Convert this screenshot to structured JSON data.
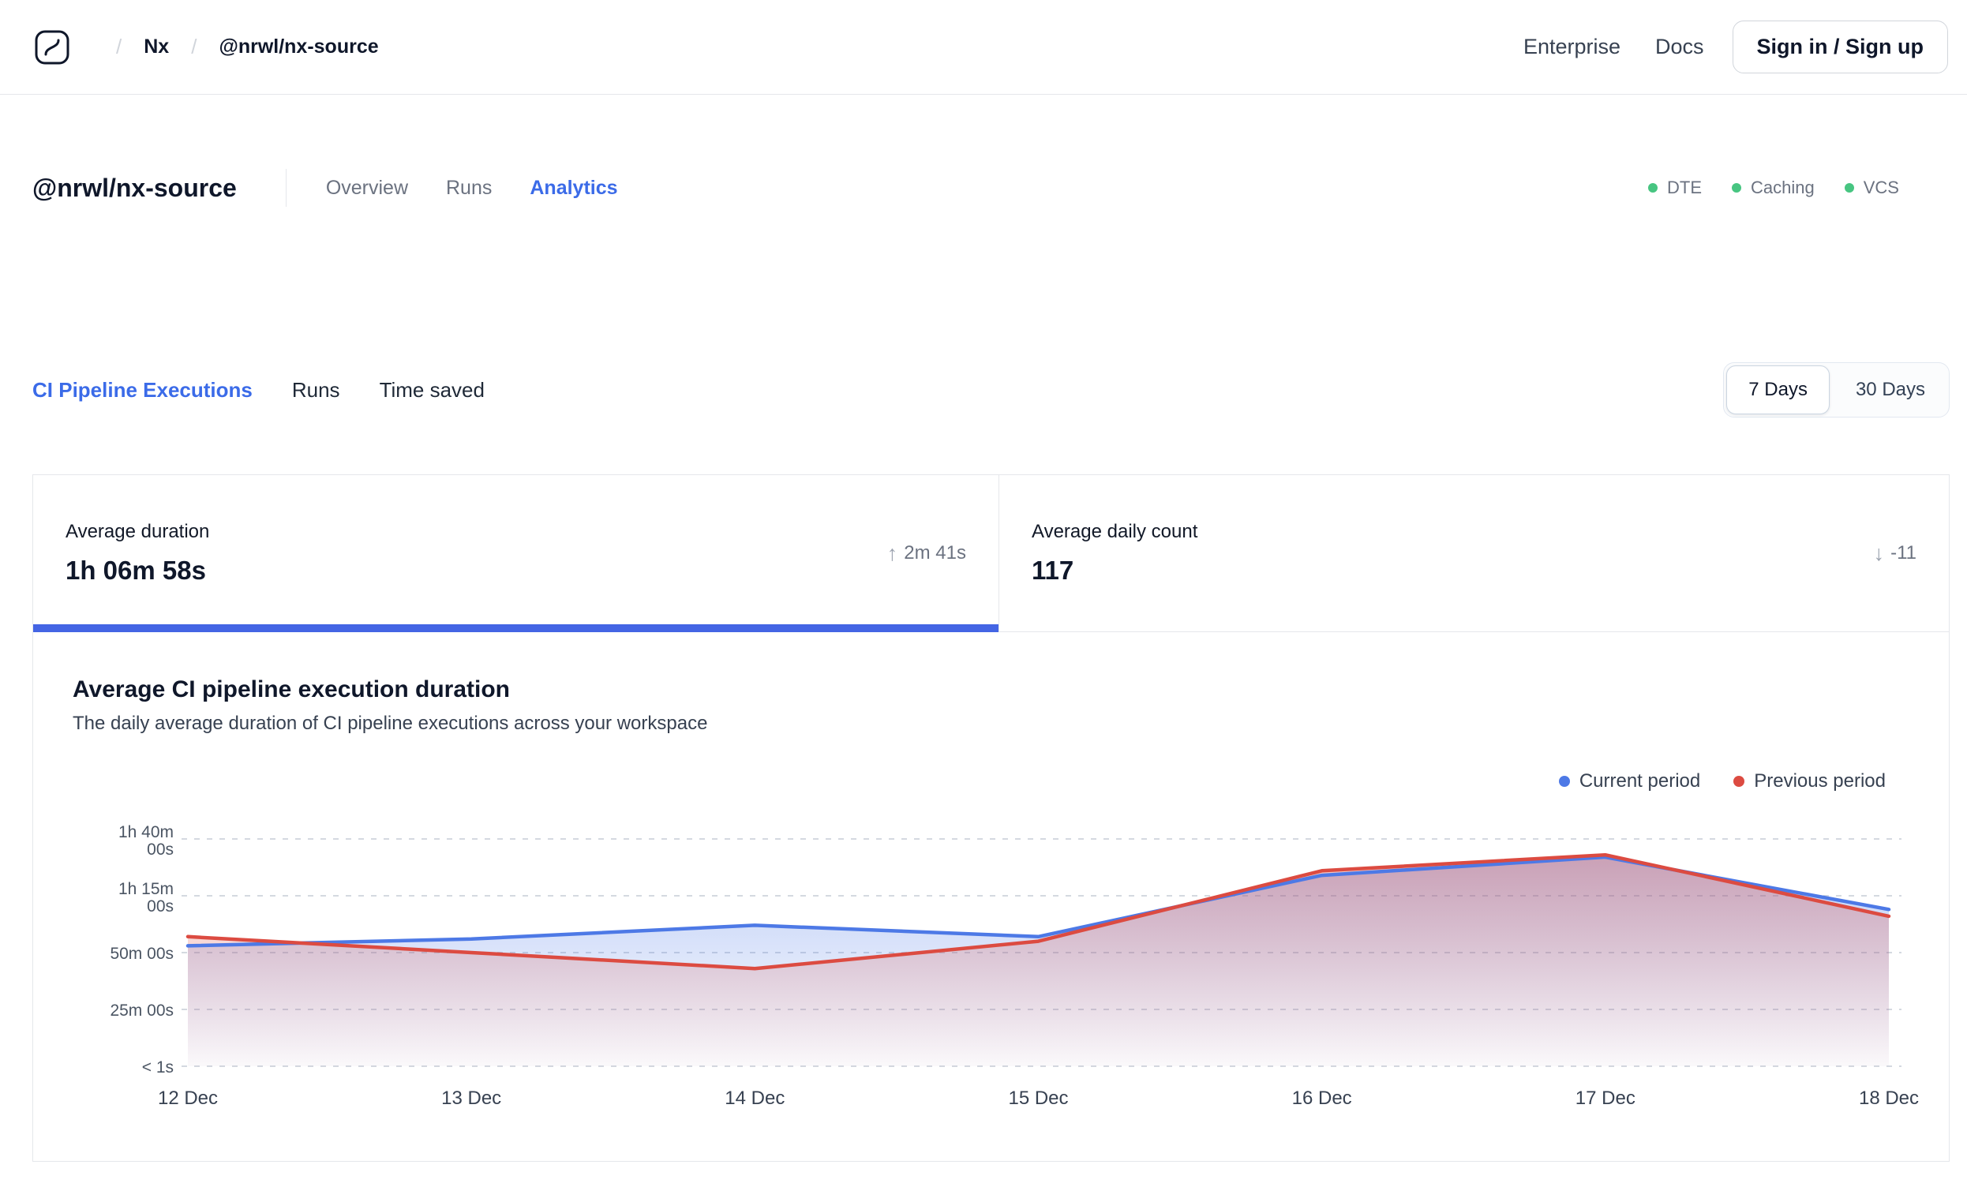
{
  "accents": {
    "blue": "#4465e4",
    "link_blue": "#3b6be8",
    "green": "#47c581",
    "border": "#e5e7eb"
  },
  "topbar": {
    "sep": "/",
    "org": "Nx",
    "repo": "@nrwl/nx-source",
    "links": [
      {
        "label": "Enterprise"
      },
      {
        "label": "Docs"
      }
    ],
    "signin_label": "Sign in / Sign up"
  },
  "workspace_header": {
    "title": "@nrwl/nx-source",
    "tabs": [
      {
        "label": "Overview",
        "active": false
      },
      {
        "label": "Runs",
        "active": false
      },
      {
        "label": "Analytics",
        "active": true
      }
    ],
    "status_badges": [
      {
        "label": "DTE"
      },
      {
        "label": "Caching"
      },
      {
        "label": "VCS"
      }
    ]
  },
  "analytics_nav": {
    "tabs": [
      {
        "label": "CI Pipeline Executions",
        "active": true
      },
      {
        "label": "Runs",
        "active": false
      },
      {
        "label": "Time saved",
        "active": false
      }
    ],
    "range_toggle": [
      {
        "label": "7 Days",
        "selected": true
      },
      {
        "label": "30 Days",
        "selected": false
      }
    ]
  },
  "metric_cards": [
    {
      "label": "Average duration",
      "value": "1h 06m 58s",
      "delta_icon": "↑",
      "delta": "2m 41s",
      "delta_direction": "up",
      "selected": true
    },
    {
      "label": "Average daily count",
      "value": "117",
      "delta_icon": "↓",
      "delta": "-11",
      "delta_direction": "down",
      "selected": false
    }
  ],
  "chart_data": {
    "type": "line",
    "title": "Average CI pipeline execution duration",
    "subtitle": "The daily average duration of CI pipeline executions across your workspace",
    "x": [
      "12 Dec",
      "13 Dec",
      "14 Dec",
      "15 Dec",
      "16 Dec",
      "17 Dec",
      "18 Dec"
    ],
    "unit": "minutes",
    "ylim": [
      0,
      100
    ],
    "y_tick_values": [
      100,
      75,
      50,
      25,
      0
    ],
    "y_tick_labels": [
      "1h 40m\n00s",
      "1h 15m\n00s",
      "50m 00s",
      "25m 00s",
      "< 1s"
    ],
    "grid": "dashed-horizontal",
    "legend_position": "top-right",
    "series": [
      {
        "name": "Current period",
        "color": "#4d79e6",
        "values": [
          53,
          56,
          62,
          57,
          84,
          92,
          69
        ]
      },
      {
        "name": "Previous period",
        "color": "#dc4b41",
        "values": [
          57,
          50,
          43,
          55,
          86,
          93,
          66
        ]
      }
    ]
  }
}
